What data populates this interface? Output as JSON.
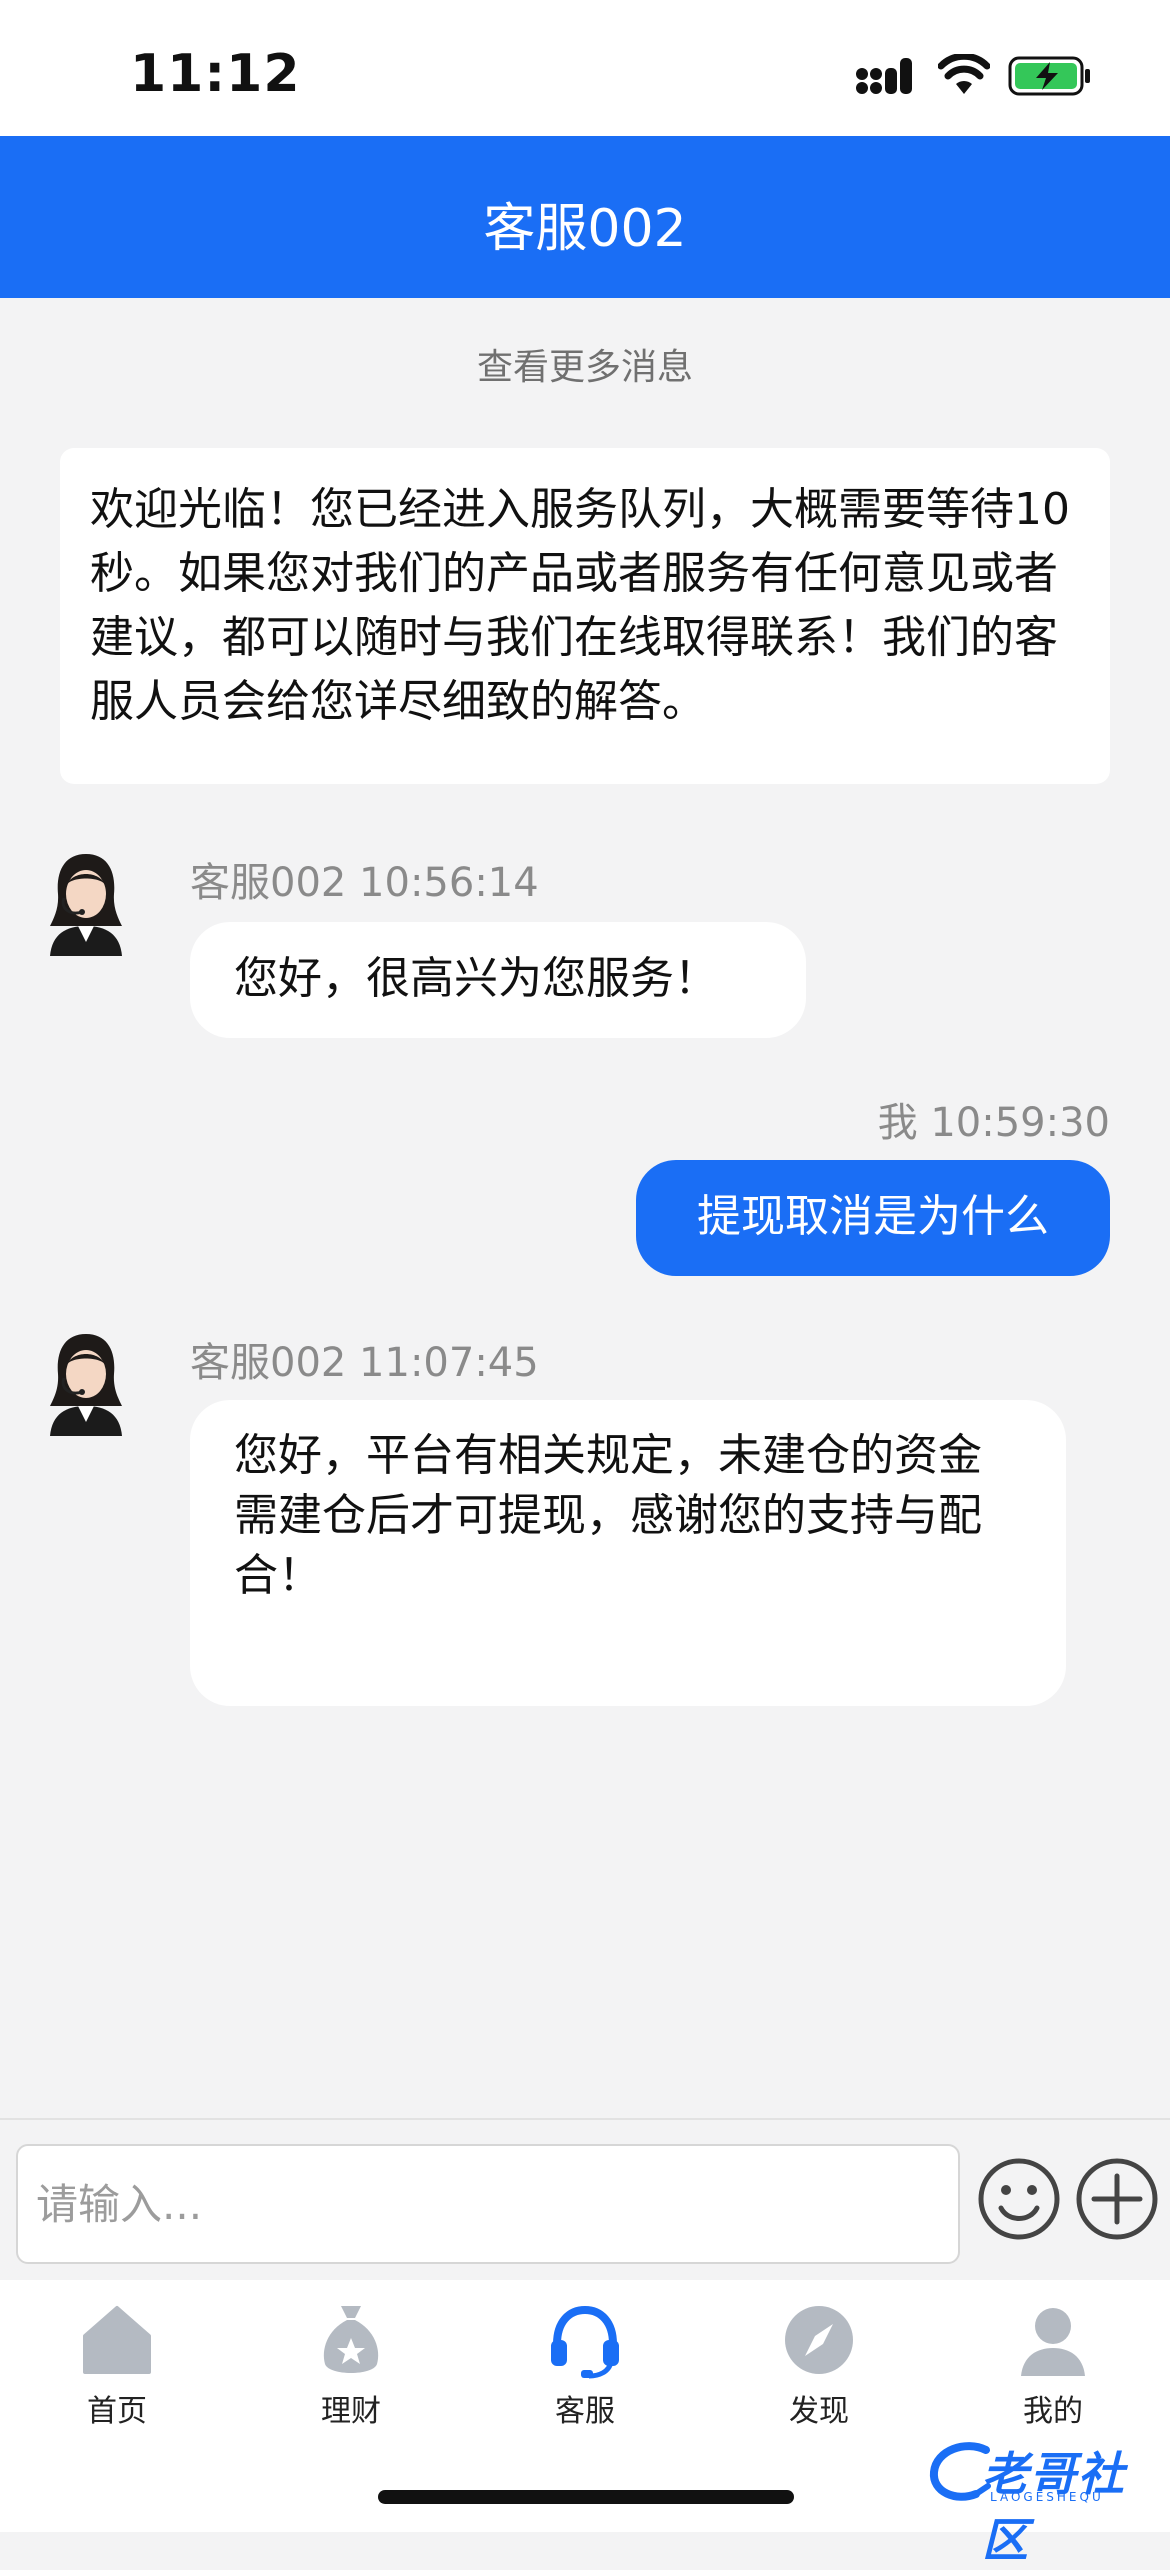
{
  "status_bar": {
    "time": "11:12"
  },
  "header": {
    "title": "客服002"
  },
  "chat": {
    "load_more": "查看更多消息",
    "welcome_text": "欢迎光临！您已经进入服务队列，大概需要等待10秒。如果您对我们的产品或者服务有任何意见或者建议，都可以随时与我们在线取得联系！我们的客服人员会给您详尽细致的解答。",
    "messages": [
      {
        "sender": "客服002",
        "time": "10:56:14",
        "meta": "客服002 10:56:14",
        "text": "您好，很高兴为您服务！"
      },
      {
        "sender": "我",
        "time": "10:59:30",
        "meta": "我 10:59:30",
        "text": "提现取消是为什么"
      },
      {
        "sender": "客服002",
        "time": "11:07:45",
        "meta": "客服002 11:07:45",
        "text": "您好，平台有相关规定，未建仓的资金需建仓后才可提现，感谢您的支持与配合！"
      }
    ]
  },
  "input": {
    "placeholder": "请输入...",
    "value": ""
  },
  "icons": {
    "emoji": "smiley-icon",
    "plus": "plus-circle-icon"
  },
  "tabbar": {
    "items": [
      {
        "label": "首页",
        "icon": "home-icon",
        "active": false
      },
      {
        "label": "理财",
        "icon": "money-bag-icon",
        "active": false
      },
      {
        "label": "客服",
        "icon": "headset-icon",
        "active": true
      },
      {
        "label": "发现",
        "icon": "compass-icon",
        "active": false
      },
      {
        "label": "我的",
        "icon": "user-icon",
        "active": false
      }
    ]
  },
  "watermark": {
    "text": "老哥社区",
    "sub": "LAOGESHEQU"
  },
  "colors": {
    "accent": "#1a6ef5",
    "background": "#f3f3f4",
    "inactive_icon": "#b4bac2"
  }
}
